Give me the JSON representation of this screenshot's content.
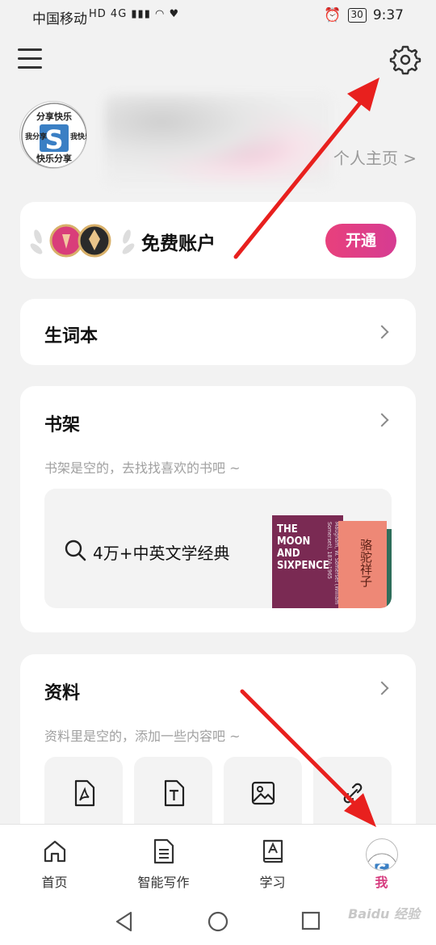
{
  "status_bar": {
    "carrier": "中国移动",
    "net_labels": "HD 4G",
    "battery": "30",
    "time": "9:37"
  },
  "profile": {
    "avatar_text_top": "分享快乐",
    "avatar_text_left": "我分享",
    "avatar_text_right": "我快乐",
    "avatar_text_bottom": "快乐分享",
    "avatar_letter": "S",
    "homepage_link": "个人主页 >"
  },
  "account": {
    "title": "免费账户",
    "open_label": "开通"
  },
  "vocab": {
    "title": "生词本"
  },
  "shelf": {
    "title": "书架",
    "empty_hint": "书架是空的，去找找喜欢的书吧 ~",
    "library_label": "4万+中英文学经典",
    "book1_title": "THE MOON AND SIXPENCE",
    "book1_spine": "Maugham, W. Somerset (William Somerset), 1874-1965",
    "book2_title": "骆驼祥子"
  },
  "materials": {
    "title": "资料",
    "empty_hint": "资料里是空的，添加一些内容吧 ~",
    "tiles": [
      {
        "icon": "pdf-file-icon"
      },
      {
        "icon": "text-file-icon"
      },
      {
        "icon": "image-file-icon"
      },
      {
        "icon": "link-icon"
      }
    ]
  },
  "bottom_nav": [
    {
      "label": "首页",
      "icon": "home-icon"
    },
    {
      "label": "智能写作",
      "icon": "document-icon"
    },
    {
      "label": "学习",
      "icon": "book-icon"
    },
    {
      "label": "我",
      "icon": "avatar"
    }
  ],
  "watermark": "Baidu 经验",
  "colors": {
    "accent": "#e0417f",
    "background": "#f2f2f2",
    "annotation_arrow": "#e8201e"
  }
}
